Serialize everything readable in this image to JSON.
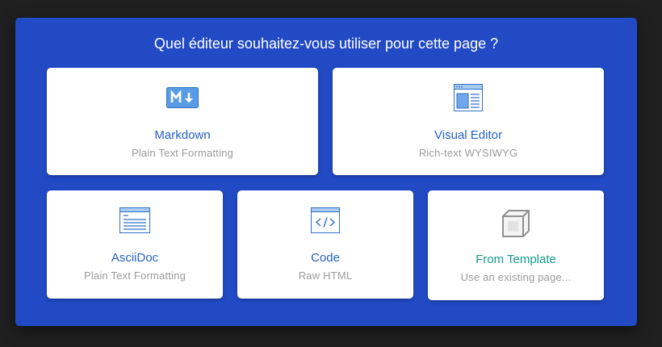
{
  "dialog": {
    "title": "Quel éditeur souhaitez-vous utiliser pour cette page ?"
  },
  "editors": [
    {
      "title": "Markdown",
      "subtitle": "Plain Text Formatting",
      "icon": "markdown-icon"
    },
    {
      "title": "Visual Editor",
      "subtitle": "Rich-text WYSIWYG",
      "icon": "visual-editor-icon"
    },
    {
      "title": "AsciiDoc",
      "subtitle": "Plain Text Formatting",
      "icon": "asciidoc-icon"
    },
    {
      "title": "Code",
      "subtitle": "Raw HTML",
      "icon": "code-icon"
    },
    {
      "title": "From Template",
      "subtitle": "Use an existing page...",
      "icon": "template-cube-icon"
    }
  ],
  "colors": {
    "dialog_bg": "#214ac4",
    "card_title": "#2361c4",
    "template_title": "#149b88",
    "subtitle": "#9a9a9a"
  }
}
